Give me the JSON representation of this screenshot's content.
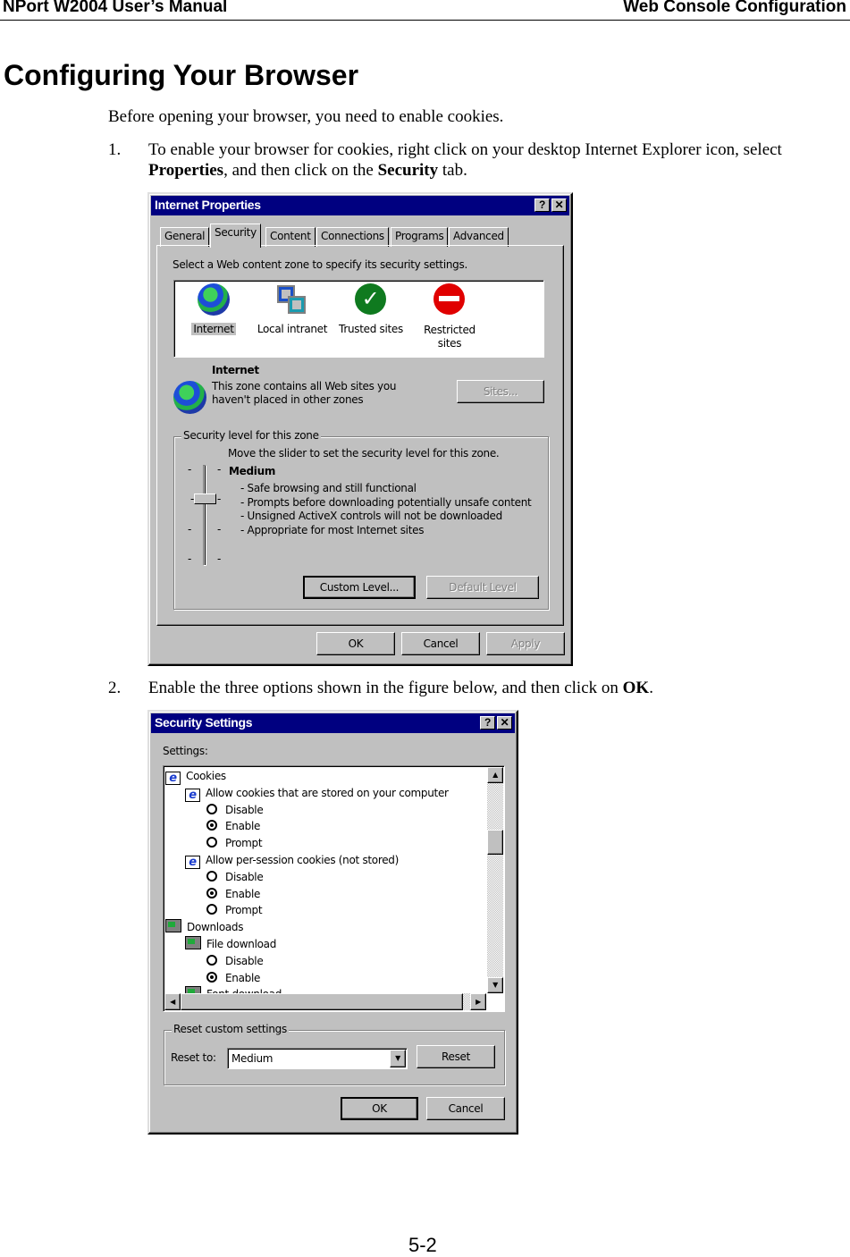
{
  "header": {
    "left": "NPort W2004 User’s Manual",
    "right": "Web Console Configuration"
  },
  "title": "Configuring Your Browser",
  "intro": "Before opening your browser, you need to enable cookies.",
  "steps": [
    {
      "num": "1.",
      "text_a": "To enable your browser for cookies, right click on your desktop Internet Explorer icon, select",
      "bold1": "Properties",
      "text_b": ", and then click on the ",
      "bold2": "Security",
      "text_c": " tab."
    },
    {
      "num": "2.",
      "text_a": "Enable the three options shown in the figure below, and then click on ",
      "bold1": "OK",
      "text_b": "."
    }
  ],
  "dialog1": {
    "title": "Internet Properties",
    "help": "?",
    "close": "✕",
    "tabs": [
      "General",
      "Security",
      "Content",
      "Connections",
      "Programs",
      "Advanced"
    ],
    "active_tab": "Security",
    "zone_prompt": "Select a Web content zone to specify its security settings.",
    "zones": [
      {
        "label": "Internet",
        "icon": "globe-icon"
      },
      {
        "label": "Local intranet",
        "icon": "computers-icon"
      },
      {
        "label": "Trusted sites",
        "icon": "check-icon"
      },
      {
        "label": "Restricted sites",
        "icon": "no-entry-icon"
      }
    ],
    "selected_zone": "Internet",
    "zone_title": "Internet",
    "zone_desc": "This zone contains all Web sites you haven't placed in other zones",
    "sites_button": "Sites...",
    "group_label": "Security level for this zone",
    "slider_prompt": "Move the slider to set the security level for this zone.",
    "level": "Medium",
    "level_bullets": [
      "- Safe browsing and still functional",
      "- Prompts before downloading potentially unsafe content",
      "- Unsigned ActiveX controls will not be downloaded",
      "- Appropriate for most Internet sites"
    ],
    "custom_level": "Custom Level...",
    "default_level": "Default Level",
    "ok": "OK",
    "cancel": "Cancel",
    "apply": "Apply"
  },
  "dialog2": {
    "title": "Security Settings",
    "help": "?",
    "close": "✕",
    "settings_label": "Settings:",
    "tree": [
      {
        "type": "cat",
        "icon": "ie",
        "label": "Cookies"
      },
      {
        "type": "item",
        "icon": "ie",
        "label": "Allow cookies that are stored on your computer"
      },
      {
        "type": "opt",
        "label": "Disable",
        "checked": false
      },
      {
        "type": "opt",
        "label": "Enable",
        "checked": true
      },
      {
        "type": "opt",
        "label": "Prompt",
        "checked": false
      },
      {
        "type": "item",
        "icon": "ie",
        "label": "Allow per-session cookies (not stored)"
      },
      {
        "type": "opt",
        "label": "Disable",
        "checked": false
      },
      {
        "type": "opt",
        "label": "Enable",
        "checked": true
      },
      {
        "type": "opt",
        "label": "Prompt",
        "checked": false
      },
      {
        "type": "cat",
        "icon": "dl",
        "label": "Downloads"
      },
      {
        "type": "item",
        "icon": "dl",
        "label": "File download"
      },
      {
        "type": "opt",
        "label": "Disable",
        "checked": false
      },
      {
        "type": "opt",
        "label": "Enable",
        "checked": true
      },
      {
        "type": "item",
        "icon": "dl",
        "label": "Font download"
      }
    ],
    "reset_group": "Reset custom settings",
    "reset_to_label": "Reset to:",
    "reset_value": "Medium",
    "reset_button": "Reset",
    "ok": "OK",
    "cancel": "Cancel"
  },
  "page_number": "5-2"
}
